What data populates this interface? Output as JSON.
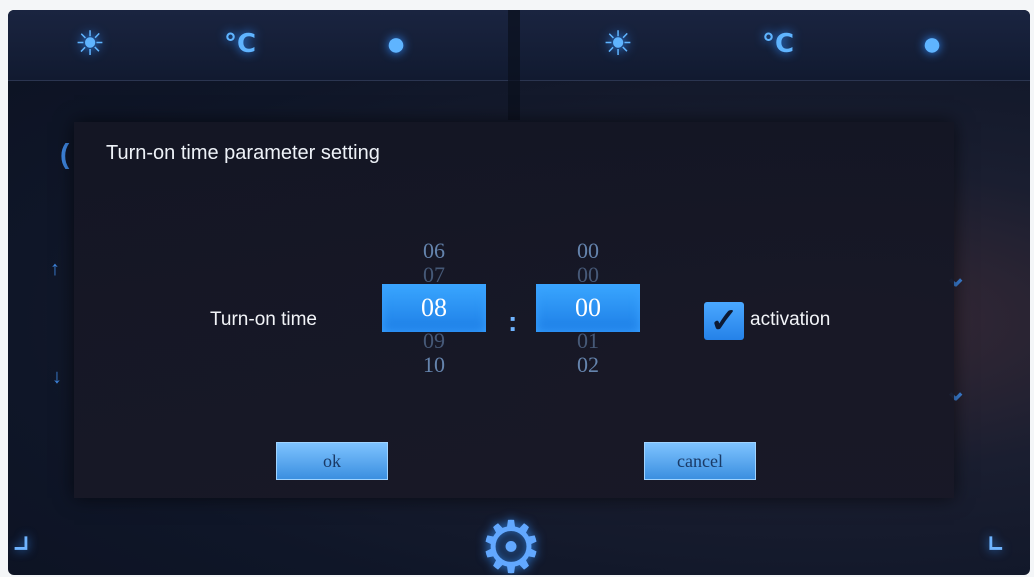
{
  "dialog": {
    "title": "Turn-on time parameter setting",
    "field_label": "Turn-on time",
    "separator": ":",
    "activation_label": "activation",
    "activation_checked": true,
    "ok_label": "ok",
    "cancel_label": "cancel"
  },
  "hour_wheel": {
    "above": [
      "06",
      "07"
    ],
    "selected": "08",
    "below": [
      "09",
      "10"
    ]
  },
  "minute_wheel": {
    "above": [
      "00",
      "00"
    ],
    "selected": "00",
    "below": [
      "01",
      "02"
    ]
  },
  "icons": {
    "top": [
      "lightbulb-icon",
      "temperature-icon",
      "water-drop-icon",
      "lightbulb-icon",
      "temperature-icon",
      "water-drop-icon"
    ],
    "temp_glyph": "°C",
    "accent": "#5fb4ff"
  }
}
